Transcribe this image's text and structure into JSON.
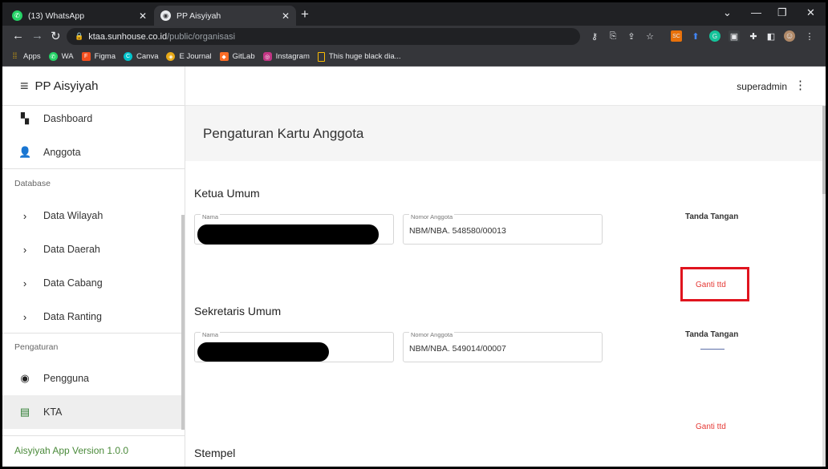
{
  "browser": {
    "tabs": [
      {
        "title": "(13) WhatsApp",
        "icon": "whatsapp-icon",
        "active": false
      },
      {
        "title": "PP Aisyiyah",
        "icon": "chrome-icon",
        "active": true
      }
    ],
    "url_host": "ktaa.sunhouse.co.id",
    "url_path": "/public/organisasi",
    "bookmarks": [
      {
        "label": "Apps",
        "icon": "apps-grid-icon"
      },
      {
        "label": "WA",
        "icon": "whatsapp-icon"
      },
      {
        "label": "Figma",
        "icon": "figma-icon"
      },
      {
        "label": "Canva",
        "icon": "canva-icon"
      },
      {
        "label": "E Journal",
        "icon": "ejournal-icon"
      },
      {
        "label": "GitLab",
        "icon": "gitlab-icon"
      },
      {
        "label": "Instagram",
        "icon": "instagram-icon"
      },
      {
        "label": "This huge black dia...",
        "icon": "bookmark-folder-icon"
      }
    ]
  },
  "sidebar": {
    "brand": "PP Aisyiyah",
    "items": [
      {
        "label": "Dashboard",
        "icon": "dashboard-icon"
      },
      {
        "label": "Anggota",
        "icon": "person-icon"
      }
    ],
    "database_heading": "Database",
    "database_items": [
      {
        "label": "Data Wilayah",
        "icon": "chevron-right-icon"
      },
      {
        "label": "Data Daerah",
        "icon": "chevron-right-icon"
      },
      {
        "label": "Data Cabang",
        "icon": "chevron-right-icon"
      },
      {
        "label": "Data Ranting",
        "icon": "chevron-right-icon"
      }
    ],
    "settings_heading": "Pengaturan",
    "settings_items": [
      {
        "label": "Pengguna",
        "icon": "account-circle-icon"
      },
      {
        "label": "KTA",
        "icon": "badge-icon",
        "active": true
      }
    ],
    "footer": "Aisyiyah App Version 1.0.0"
  },
  "header": {
    "user": "superadmin"
  },
  "main": {
    "title": "Pengaturan Kartu Anggota",
    "sections": [
      {
        "heading": "Ketua Umum",
        "name_label": "Nama",
        "nomor_label": "Nomor Anggota",
        "nomor_value": "NBM/NBA. 548580/00013",
        "ttd_label": "Tanda Tangan",
        "ganti_label": "Ganti ttd"
      },
      {
        "heading": "Sekretaris Umum",
        "name_label": "Nama",
        "nomor_label": "Nomor Anggota",
        "nomor_value": "NBM/NBA. 549014/00007",
        "ttd_label": "Tanda Tangan",
        "ganti_label": "Ganti ttd"
      }
    ],
    "stempel_heading": "Stempel"
  },
  "colors": {
    "accent_red": "#e53935",
    "highlight_red": "#e0141e",
    "footer_green": "#4a8a3a"
  }
}
